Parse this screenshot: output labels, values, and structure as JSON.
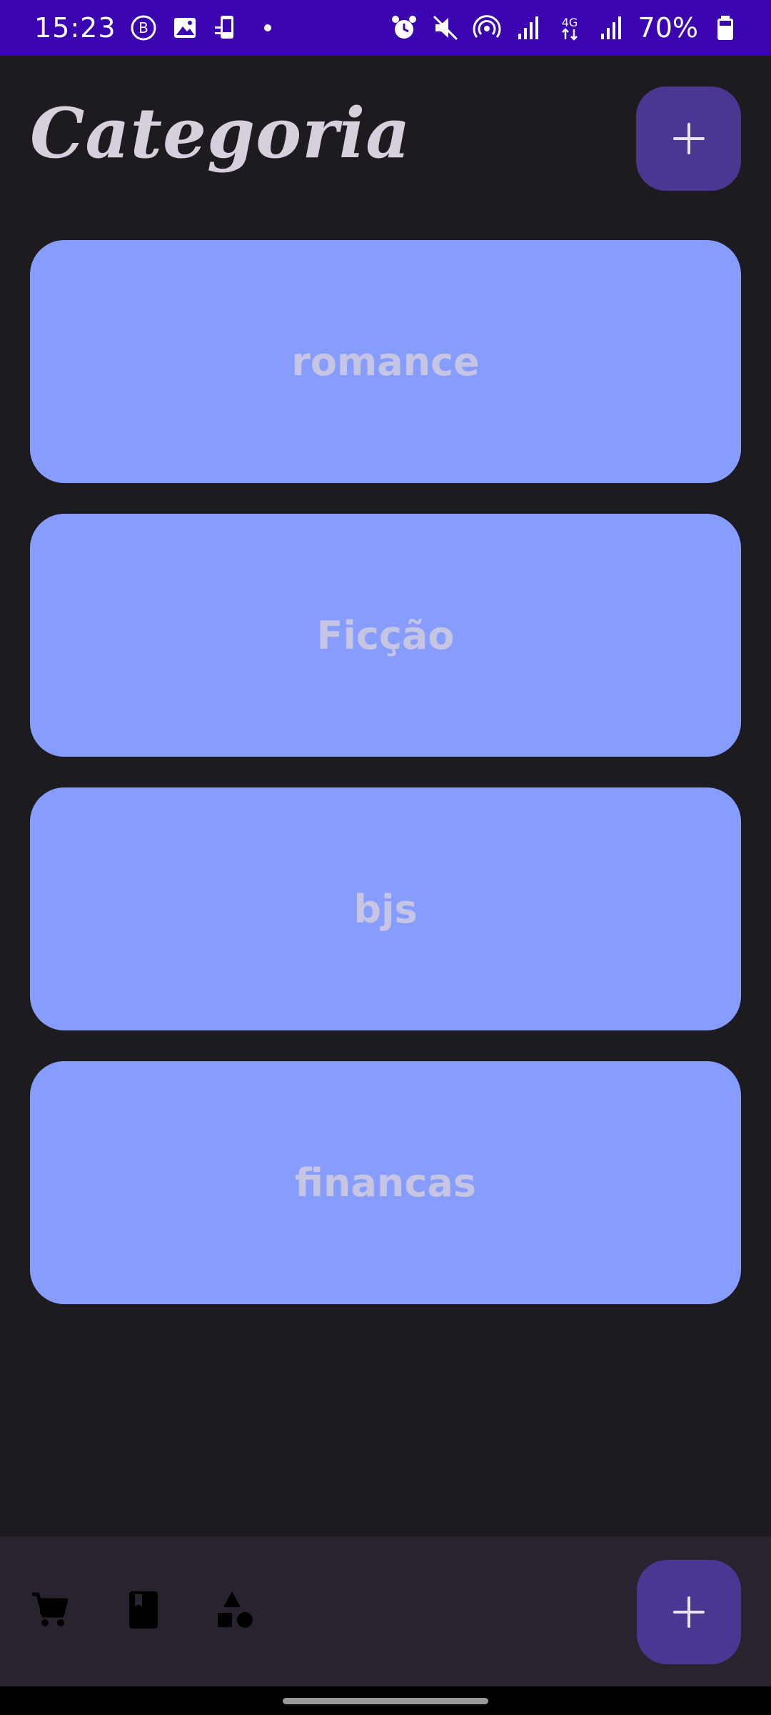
{
  "status_bar": {
    "time": "15:23",
    "battery": "70%",
    "left_icons": [
      "b-badge-icon",
      "gallery-icon",
      "phone-sync-icon",
      "dot-icon"
    ],
    "right_icons": [
      "alarm-icon",
      "mute-icon",
      "hotspot-icon",
      "signal-icon",
      "network-4g-icon",
      "signal-icon",
      "battery-icon"
    ],
    "network_label": "4G"
  },
  "header": {
    "title": "Categoria",
    "add_button_symbol": "+"
  },
  "categories": [
    {
      "label": "romance"
    },
    {
      "label": "Ficção"
    },
    {
      "label": "bjs"
    },
    {
      "label": "financas"
    }
  ],
  "bottom_bar": {
    "nav_items": [
      {
        "icon": "cart-icon"
      },
      {
        "icon": "book-icon"
      },
      {
        "icon": "category-shapes-icon"
      }
    ],
    "add_button_symbol": "+"
  },
  "colors": {
    "status_bar": "#3a05b0",
    "background": "#1d1b20",
    "card": "#879cff",
    "card_text": "#c6c6e4",
    "fab": "#4a3791",
    "bottom_bar": "#28232f"
  }
}
